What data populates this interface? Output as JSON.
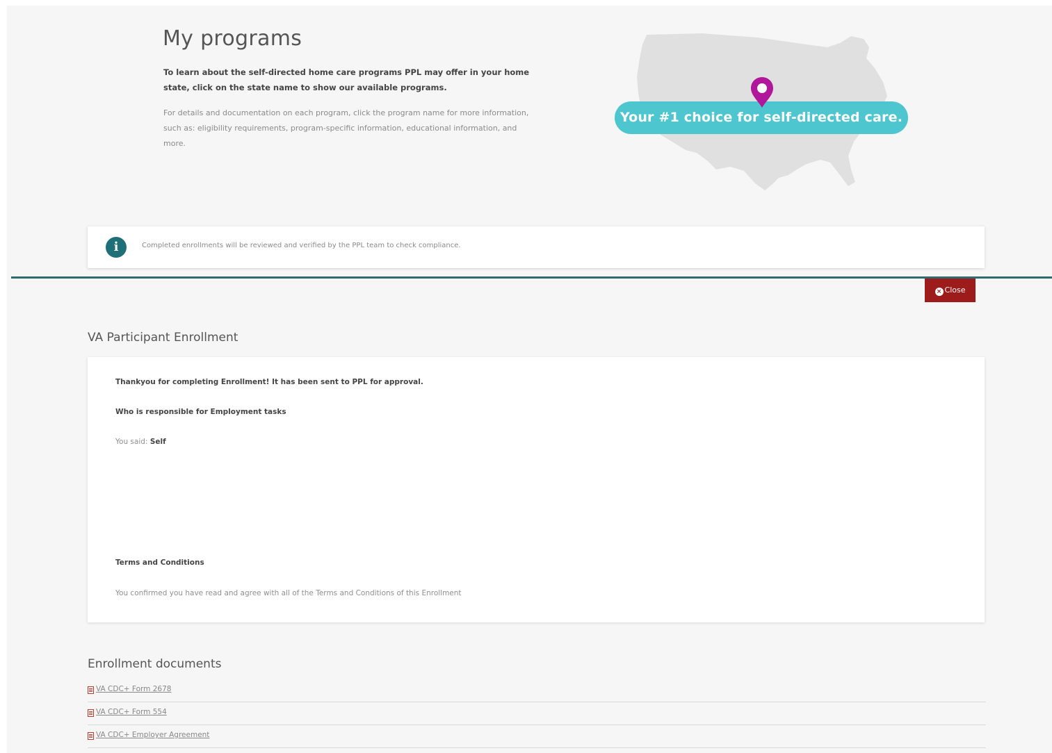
{
  "header": {
    "title": "My programs",
    "intro_bold": "To learn about the self-directed home care programs PPL may offer in your home state, click on the state name to show our available programs.",
    "intro_light": "For details and documentation on each program, click the program name for more information, such as: eligibility requirements, program-specific information, educational information, and more.",
    "tagline": "Your #1 choice for self-directed care.",
    "map_icon": "us-map-icon",
    "pin_icon": "location-pin-icon"
  },
  "info_banner": {
    "icon": "info-icon",
    "icon_glyph": "i",
    "text": "Completed enrollments will be reviewed and verified by the PPL team to check compliance."
  },
  "close_button": {
    "icon": "close-circle-icon",
    "label": "Close"
  },
  "enrollment": {
    "title": "VA Participant Enrollment",
    "thank_you": "Thankyou for completing Enrollment! It has been sent to PPL for approval.",
    "question": "Who is responsible for Employment tasks",
    "answer_prefix": "You said:",
    "answer_value": "Self",
    "terms_title": "Terms and Conditions",
    "terms_text": "You confirmed you have read and agree with all of the Terms and Conditions of this Enrollment"
  },
  "documents": {
    "title": "Enrollment documents",
    "items": [
      {
        "label": "VA CDC+ Form 2678",
        "icon": "pdf-icon"
      },
      {
        "label": "VA CDC+ Form 554",
        "icon": "pdf-icon"
      },
      {
        "label": "VA CDC+ Employer Agreement",
        "icon": "pdf-icon"
      }
    ]
  },
  "colors": {
    "accent_teal": "#4ec6d0",
    "divider": "#2f6a70",
    "close_red": "#9e1b1b",
    "pin_magenta": "#b0179a"
  }
}
